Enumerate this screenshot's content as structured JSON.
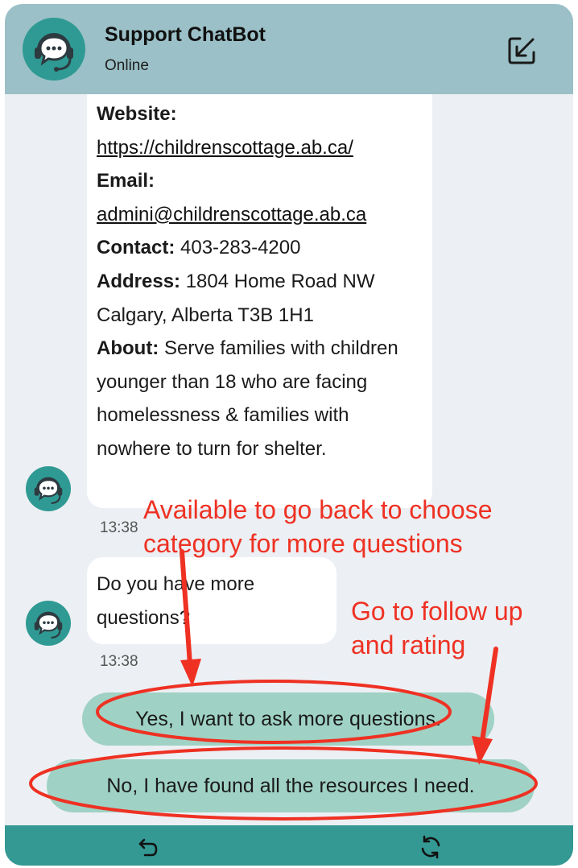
{
  "header": {
    "title": "Support ChatBot",
    "status": "Online"
  },
  "messages": [
    {
      "sender": "bot",
      "fields": [
        {
          "label": "Website:",
          "value": "https://childrenscottage.ab.ca/",
          "link": true
        },
        {
          "label": "Email:",
          "value": "admini@childrenscottage.ab.ca",
          "link": true
        },
        {
          "label": "Contact:",
          "value": " 403-283-4200"
        },
        {
          "label": "Address:",
          "value": " 1804 Home Road NW Calgary, Alberta T3B 1H1"
        },
        {
          "label": "About:",
          "value": " Serve families with children younger than 18 who are facing homelessness & families with nowhere to turn for shelter."
        }
      ],
      "time": "13:38"
    },
    {
      "sender": "bot",
      "text": "Do you have more questions?",
      "time": "13:38"
    }
  ],
  "options": [
    {
      "label": "Yes, I want to ask more questions."
    },
    {
      "label": "No, I have found all the resources I need."
    }
  ],
  "annotations": {
    "note1": [
      "Available to go back to choose",
      "category for more questions"
    ],
    "note2": [
      "Go to follow up",
      "and rating"
    ],
    "color": "#ee3123"
  },
  "icons": {
    "bot_avatar": "chat-headset-icon",
    "minimize": "minimize-arrow-icon",
    "back": "undo-arrow-icon",
    "refresh": "refresh-icon"
  },
  "colors": {
    "header_bg": "#9bc0c7",
    "accent": "#2f9a93",
    "option_bg": "#9fd2c4",
    "footer_bg": "#349893",
    "chat_bg": "#eceff3"
  }
}
